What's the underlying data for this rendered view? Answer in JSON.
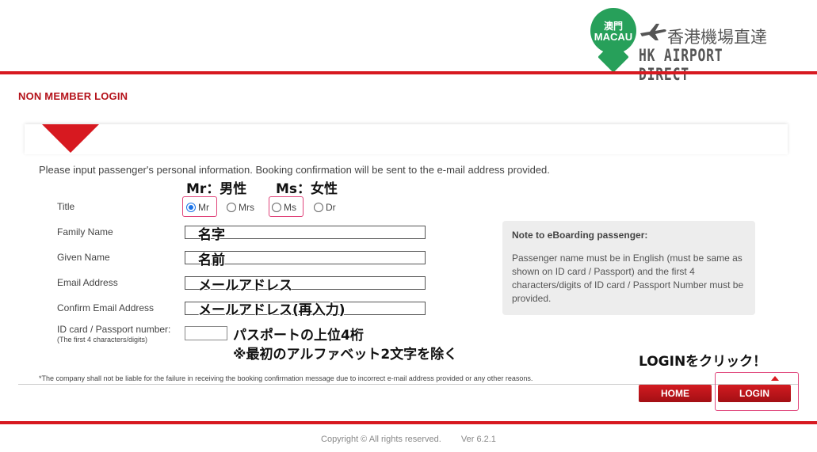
{
  "header": {
    "logo_badge_top": "澳門",
    "logo_badge_bottom": "MACAU",
    "logo_title_cn": "香港機場直達",
    "logo_title_en": "HK AIRPORT DIRECT"
  },
  "section_title": "NON MEMBER LOGIN",
  "intro": "Please input passenger's personal information. Booking confirmation will be sent to the e-mail address provided.",
  "form": {
    "title_label": "Title",
    "title_options": [
      "Mr",
      "Mrs",
      "Ms",
      "Dr"
    ],
    "title_selected": "Mr",
    "family_name_label": "Family Name",
    "given_name_label": "Given Name",
    "email_label": "Email Address",
    "confirm_email_label": "Confirm Email Address",
    "id_label": "ID card / Passport number:",
    "id_sublabel": "(The first 4 characters/digits)"
  },
  "annotations": {
    "mr": "Mr：男性",
    "ms": "Ms：女性",
    "family_name": "名字",
    "given_name": "名前",
    "email": "メールアドレス",
    "confirm_email": "メールアドレス(再入力)",
    "passport_line1": "パスポートの上位4桁",
    "passport_line2": "※最初のアルファベット2文字を除く",
    "login": "LOGINをクリック！"
  },
  "note": {
    "title": "Note to eBoarding passenger:",
    "body": "Passenger name must be in English (must be same as shown on ID card / Passport) and the first 4 characters/digits of ID card / Passport Number must be provided."
  },
  "disclaimer": "*The company shall not be liable for the failure in receiving the booking confirmation message due to incorrect e-mail address provided or any other reasons.",
  "buttons": {
    "home": "HOME",
    "login": "LOGIN"
  },
  "footer": {
    "copyright": "Copyright © All rights reserved.",
    "version": "Ver 6.2.1"
  },
  "colors": {
    "brand_red": "#d71920",
    "title_red": "#b4121a",
    "logo_green": "#27a05a",
    "highlight_pink": "#e0457b"
  }
}
